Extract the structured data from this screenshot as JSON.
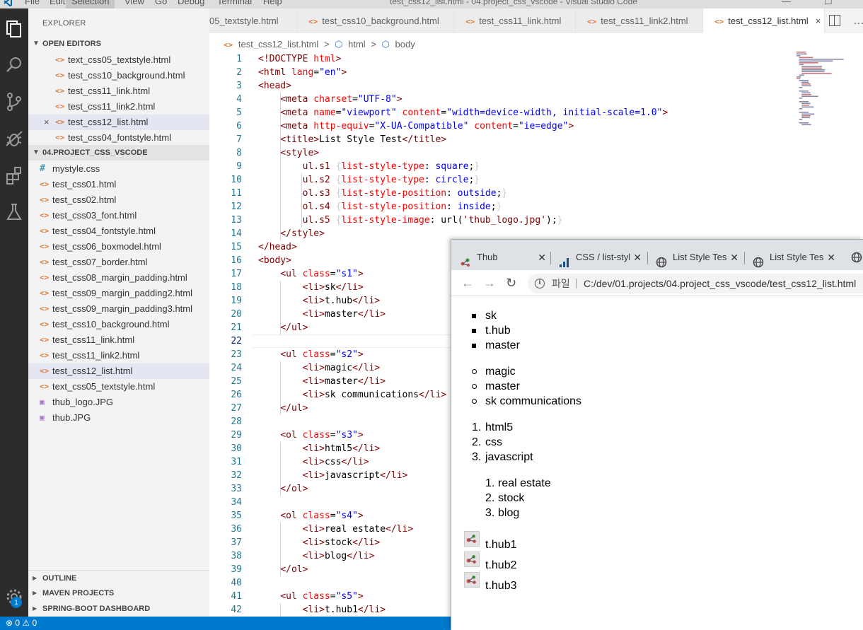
{
  "window": {
    "title": "test_css12_list.html - 04.project_css_vscode - Visual Studio Code",
    "menu": [
      "File",
      "Edit",
      "Selection",
      "View",
      "Go",
      "Debug",
      "Terminal",
      "Help"
    ],
    "active_menu": "Selection"
  },
  "activity_bar": {
    "items": [
      "explorer-icon",
      "search-icon",
      "source-control-icon",
      "debug-icon",
      "extensions-icon",
      "test-flask-icon"
    ],
    "settings_badge": "1"
  },
  "sidebar": {
    "title": "EXPLORER",
    "open_editors_label": "OPEN EDITORS",
    "open_editors": [
      "text_css05_textstyle.html",
      "test_css10_background.html",
      "test_css11_link.html",
      "test_css11_link2.html",
      "test_css12_list.html",
      "test_css04_fontstyle.html"
    ],
    "project_label": "04.PROJECT_CSS_VSCODE",
    "files": [
      {
        "name": "mystyle.css",
        "kind": "css"
      },
      {
        "name": "test_css01.html",
        "kind": "html"
      },
      {
        "name": "test_css02.html",
        "kind": "html"
      },
      {
        "name": "test_css03_font.html",
        "kind": "html"
      },
      {
        "name": "test_css04_fontstyle.html",
        "kind": "html"
      },
      {
        "name": "test_css06_boxmodel.html",
        "kind": "html"
      },
      {
        "name": "test_css07_border.html",
        "kind": "html"
      },
      {
        "name": "test_css08_margin_padding.html",
        "kind": "html"
      },
      {
        "name": "test_css09_margin_padding2.html",
        "kind": "html"
      },
      {
        "name": "test_css09_margin_padding3.html",
        "kind": "html"
      },
      {
        "name": "test_css10_background.html",
        "kind": "html"
      },
      {
        "name": "test_css11_link.html",
        "kind": "html"
      },
      {
        "name": "test_css11_link2.html",
        "kind": "html"
      },
      {
        "name": "test_css12_list.html",
        "kind": "html"
      },
      {
        "name": "text_css05_textstyle.html",
        "kind": "html"
      },
      {
        "name": "thub_logo.JPG",
        "kind": "image"
      },
      {
        "name": "thub.JPG",
        "kind": "image"
      }
    ],
    "bottom_sections": [
      "OUTLINE",
      "MAVEN PROJECTS",
      "SPRING-BOOT DASHBOARD"
    ]
  },
  "tabs": [
    {
      "label": "05_textstyle.html",
      "icon": "<>"
    },
    {
      "label": "test_css10_background.html",
      "icon": "<>"
    },
    {
      "label": "test_css11_link.html",
      "icon": "<>"
    },
    {
      "label": "test_css11_link2.html",
      "icon": "<>"
    },
    {
      "label": "test_css12_list.html",
      "icon": "<>",
      "close": "×"
    }
  ],
  "breadcrumb": {
    "file": "test_css12_list.html",
    "sep": ">",
    "items": [
      "html",
      "body"
    ],
    "file_icon": "<>"
  },
  "editor": {
    "current_line": 22,
    "lines": [
      "<!DOCTYPE html>",
      "<html lang=\"en\">",
      "<head>",
      "    <meta charset=\"UTF-8\">",
      "    <meta name=\"viewport\" content=\"width=device-width, initial-scale=1.0\">",
      "    <meta http-equiv=\"X-UA-Compatible\" content=\"ie=edge\">",
      "    <title>List Style Test</title>",
      "    <style>",
      "        ul.s1 {list-style-type: square;}",
      "        ul.s2 {list-style-type: circle;}",
      "        ol.s3 {list-style-position: outside;}",
      "        ol.s4 {list-style-position: inside;}",
      "        ul.s5 {list-style-image: url('thub_logo.jpg');}",
      "    </style>",
      "</head>",
      "<body>",
      "    <ul class=\"s1\">",
      "        <li>sk</li>",
      "        <li>t.hub</li>",
      "        <li>master</li>",
      "    </ul>",
      "",
      "    <ul class=\"s2\">",
      "        <li>magic</li>",
      "        <li>master</li>",
      "        <li>sk communications</li>",
      "    </ul>",
      "",
      "    <ol class=\"s3\">",
      "        <li>html5</li>",
      "        <li>css</li>",
      "        <li>javascript</li>",
      "    </ol>",
      "",
      "    <ol class=\"s4\">",
      "        <li>real estate</li>",
      "        <li>stock</li>",
      "        <li>blog</li>",
      "    </ol>",
      "",
      "    <ul class=\"s5\">",
      "        <li>t.hub1</li>"
    ]
  },
  "status_bar": {
    "errors": "0",
    "warnings": "0"
  },
  "browser": {
    "tabs": [
      {
        "label": "Thub",
        "icon": "thub-icon"
      },
      {
        "label": "CSS / list-styl",
        "icon": "chart-icon"
      },
      {
        "label": "List Style Tes",
        "icon": "globe-icon"
      },
      {
        "label": "List Style Tes",
        "icon": "globe-icon"
      }
    ],
    "address": {
      "scheme_label": "파일",
      "url": "C:/dev/01.projects/04.project_css_vscode/test_css12_list.html"
    },
    "content": {
      "square_list": [
        "sk",
        "t.hub",
        "master"
      ],
      "circle_list": [
        "magic",
        "master",
        "sk communications"
      ],
      "outside_list": [
        "html5",
        "css",
        "javascript"
      ],
      "inside_list": [
        "real estate",
        "stock",
        "blog"
      ],
      "image_list": [
        "t.hub1",
        "t.hub2",
        "t.hub3"
      ]
    }
  }
}
